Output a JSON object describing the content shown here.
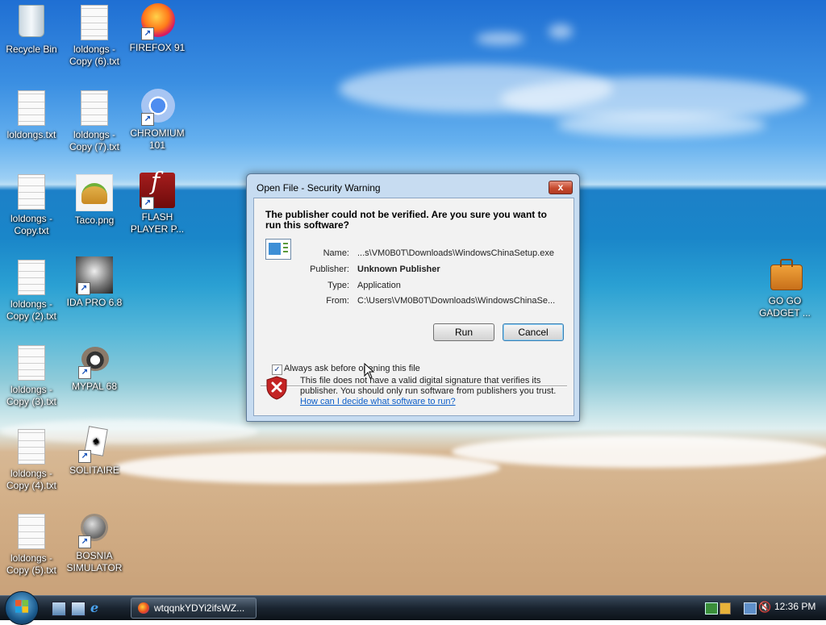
{
  "desktop_icons": [
    {
      "label": "Recycle Bin"
    },
    {
      "label": "loldongs - Copy (6).txt"
    },
    {
      "label": "FIREFOX 91"
    },
    {
      "label": "loldongs.txt"
    },
    {
      "label": "loldongs - Copy (7).txt"
    },
    {
      "label": "CHROMIUM 101"
    },
    {
      "label": "loldongs - Copy.txt"
    },
    {
      "label": "Taco.png"
    },
    {
      "label": "FLASH PLAYER P..."
    },
    {
      "label": "loldongs - Copy (2).txt"
    },
    {
      "label": "IDA PRO 6.8"
    },
    {
      "label": "loldongs - Copy (3).txt"
    },
    {
      "label": "MYPAL 68"
    },
    {
      "label": "loldongs - Copy (4).txt"
    },
    {
      "label": "SOLITAIRE"
    },
    {
      "label": "loldongs - Copy (5).txt"
    },
    {
      "label": "BOSNIA SIMULATOR"
    },
    {
      "label": "GO GO GADGET ..."
    }
  ],
  "dialog": {
    "title": "Open File - Security Warning",
    "close_glyph": "x",
    "question": "The publisher could not be verified.  Are you sure you want to run this software?",
    "fields": {
      "name_label": "Name:",
      "name_value": "...s\\VM0B0T\\Downloads\\WindowsChinaSetup.exe",
      "publisher_label": "Publisher:",
      "publisher_value": "Unknown Publisher",
      "type_label": "Type:",
      "type_value": "Application",
      "from_label": "From:",
      "from_value": "C:\\Users\\VM0B0T\\Downloads\\WindowsChinaSe..."
    },
    "run_label": "Run",
    "cancel_label": "Cancel",
    "checkbox_label": "Always ask before opening this file",
    "checkbox_checked": true,
    "warning_text": "This file does not have a valid digital signature that verifies its publisher.  You should only run software from publishers you trust.",
    "help_link": "How can I decide what software to run?"
  },
  "taskbar": {
    "task_label": "wtqqnkYDYi2ifsWZ...",
    "clock": "12:36 PM"
  }
}
